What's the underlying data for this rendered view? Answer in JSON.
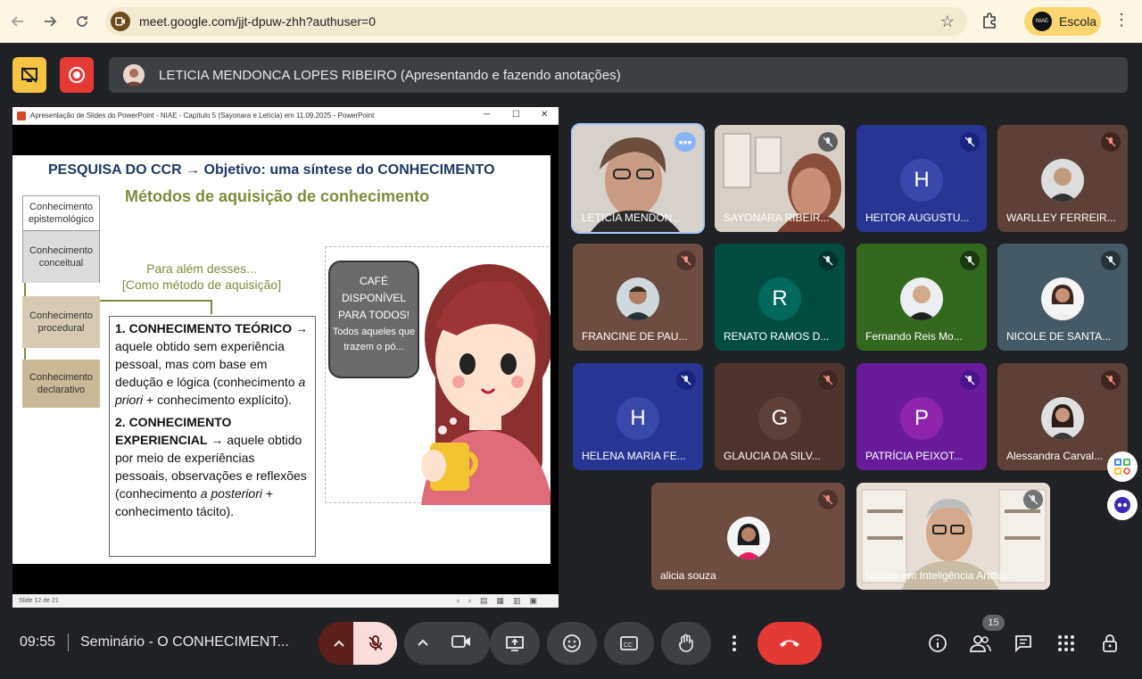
{
  "browser": {
    "url": "meet.google.com/jjt-dpuw-zhh?authuser=0",
    "profile_name": "Escola"
  },
  "presenter_bar": {
    "text": "LETICIA MENDONCA LOPES RIBEIRO (Apresentando e fazendo anotações)"
  },
  "powerpoint": {
    "window_title": "Apresentação de Slides do PowerPoint  -  NIAE - Capítulo 5 (Sayonara e Letícia) em 11.09.2025 - PowerPoint",
    "slide_status": "Slide 12 de 21"
  },
  "slide": {
    "title": "PESQUISA DO CCR → Objetivo: uma síntese do CONHECIMENTO",
    "subtitle": "Métodos de aquisição de conhecimento",
    "categories": [
      "Conhecimento epistemológico",
      "Conhecimento conceitual",
      "Conhecimento procedural",
      "Conhecimento declarativo"
    ],
    "green_line1": "Para além desses...",
    "green_line2": "[Como método de aquisição]",
    "item1_heading": "1. CONHECIMENTO TEÓRICO",
    "item1_body_a": " → aquele obtido sem experiência pessoal, mas com base em dedução e lógica (conhecimento ",
    "item1_italic": "a priori",
    "item1_body_b": " + conhecimento explícito).",
    "item2_heading": "2. CONHECIMENTO EXPERIENCIAL",
    "item2_body_a": " → aquele obtido por meio de experiências pessoais, observações e reflexões (conhecimento ",
    "item2_italic": "a posteriori",
    "item2_body_b": " + conhecimento tácito).",
    "bubble_lines": [
      "CAFÉ",
      "DISPONÍVEL",
      "PARA TODOS!",
      "Todos aqueles que",
      "trazem o pó..."
    ]
  },
  "participants": [
    {
      "name": "LETICIA MENDON...",
      "avatar": "video",
      "bg": "#c8c3bc"
    },
    {
      "name": "SAYONARA RIBEIR...",
      "avatar": "video",
      "bg": "#b9a89a"
    },
    {
      "name": "HEITOR AUGUSTU...",
      "avatar": "H",
      "bg": "#283593",
      "av_bg": "#3949ab"
    },
    {
      "name": "WARLLEY FERREIR...",
      "avatar": "photo",
      "bg": "#5d4037"
    },
    {
      "name": "FRANCINE DE PAU...",
      "avatar": "photo",
      "bg": "#6d4c41"
    },
    {
      "name": "RENATO RAMOS D...",
      "avatar": "R",
      "bg": "#004d40",
      "av_bg": "#00695c"
    },
    {
      "name": "Fernando Reis Mo...",
      "avatar": "photo",
      "bg": "#33691e"
    },
    {
      "name": "NICOLE DE SANTA...",
      "avatar": "photo",
      "bg": "#455a64"
    },
    {
      "name": "HELENA MARIA FE...",
      "avatar": "H",
      "bg": "#283593",
      "av_bg": "#3949ab"
    },
    {
      "name": "GLAUCIA DA SILV...",
      "avatar": "G",
      "bg": "#4e342e",
      "av_bg": "#5d4037"
    },
    {
      "name": "PATRÍCIA PEIXOT...",
      "avatar": "P",
      "bg": "#6a1b9a",
      "av_bg": "#8e24aa"
    },
    {
      "name": "Alessandra Carval...",
      "avatar": "photo",
      "bg": "#5d4037"
    },
    {
      "name": "alicia souza",
      "avatar": "photo",
      "bg": "#6d4c41"
    },
    {
      "name": "Núcleo em Inteligência Artifici...",
      "avatar": "video",
      "bg": "#d7ccc8"
    }
  ],
  "bottom": {
    "time": "09:55",
    "meeting_title": "Seminário - O CONHECIMENT...",
    "people_count": "15"
  },
  "colors": {
    "end_call": "#e53935",
    "mic_off_bg": "#f9dedc",
    "accent_blue": "#8ab4f8"
  }
}
